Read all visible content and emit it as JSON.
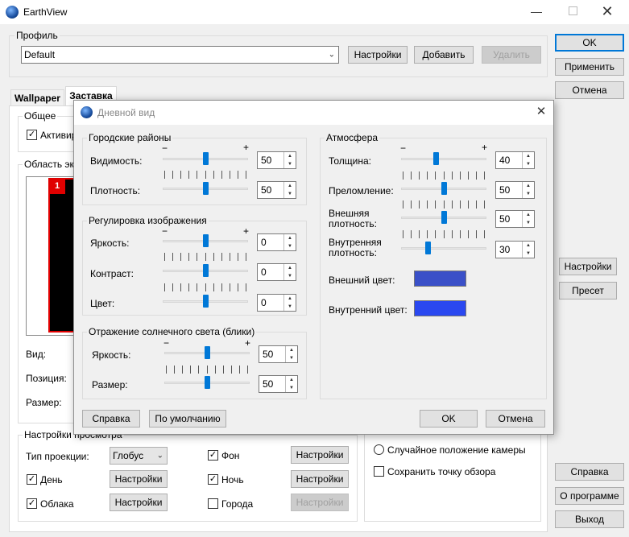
{
  "window": {
    "title": "EarthView"
  },
  "profile": {
    "label": "Профиль",
    "value": "Default",
    "settings_label": "Настройки",
    "add_label": "Добавить",
    "delete_label": "Удалить"
  },
  "right_buttons": {
    "ok": "OK",
    "apply": "Применить",
    "cancel": "Отмена",
    "settings": "Настройки",
    "preset": "Пресет",
    "help": "Справка",
    "about": "О программе",
    "exit": "Выход"
  },
  "tabs": [
    {
      "label": "Wallpaper"
    },
    {
      "label": "Заставка"
    }
  ],
  "background": {
    "general_title": "Общее",
    "activate_label": "Активир",
    "screen_area_title": "Область экр",
    "monitor_number": "1",
    "view_label": "Вид:",
    "position_label": "Позиция:",
    "size_label": "Размер:",
    "preview_title": "Настройки просмотра",
    "projection_label": "Тип проекции:",
    "projection_value": "Глобус",
    "day_label": "День",
    "clouds_label": "Облака",
    "bg_label": "Фон",
    "night_label": "Ночь",
    "cities_label": "Города",
    "settings_label": "Настройки",
    "random_camera_label": "Случайное положение камеры",
    "save_view_label": "Сохранить точку обзора",
    "checks": {
      "activate": true,
      "day": true,
      "clouds": true,
      "bg": true,
      "night": true,
      "cities": false
    }
  },
  "dialog": {
    "title": "Дневной вид",
    "minus": "−",
    "plus": "+",
    "urban": {
      "title": "Городские районы",
      "visibility_label": "Видимость:",
      "visibility": "50",
      "visibility_level": 0.5,
      "density_label": "Плотность:",
      "density": "50",
      "density_level": 0.5
    },
    "image": {
      "title": "Регулировка изображения",
      "brightness_label": "Яркость:",
      "brightness": "0",
      "brightness_level": 0.5,
      "contrast_label": "Контраст:",
      "contrast": "0",
      "contrast_level": 0.5,
      "color_label": "Цвет:",
      "color": "0",
      "color_level": 0.5
    },
    "glare": {
      "title": "Отражение солнечного света (блики)",
      "brightness_label": "Яркость:",
      "brightness": "50",
      "brightness_level": 0.5,
      "size_label": "Размер:",
      "size": "50",
      "size_level": 0.5
    },
    "atmosphere": {
      "title": "Атмосфера",
      "thickness_label": "Толщина:",
      "thickness": "40",
      "thickness_level": 0.4,
      "refraction_label": "Преломление:",
      "refraction": "50",
      "refraction_level": 0.5,
      "outer_density_label": "Внешняя плотность:",
      "outer_density": "50",
      "outer_density_level": 0.5,
      "inner_density_label": "Внутренняя плотность:",
      "inner_density": "30",
      "inner_density_level": 0.3,
      "outer_color_label": "Внешний цвет:",
      "outer_color": "#3a50c8",
      "inner_color_label": "Внутренний цвет:",
      "inner_color": "#2a48f0"
    },
    "help_label": "Справка",
    "default_label": "По умолчанию",
    "ok_label": "OK",
    "cancel_label": "Отмена"
  }
}
